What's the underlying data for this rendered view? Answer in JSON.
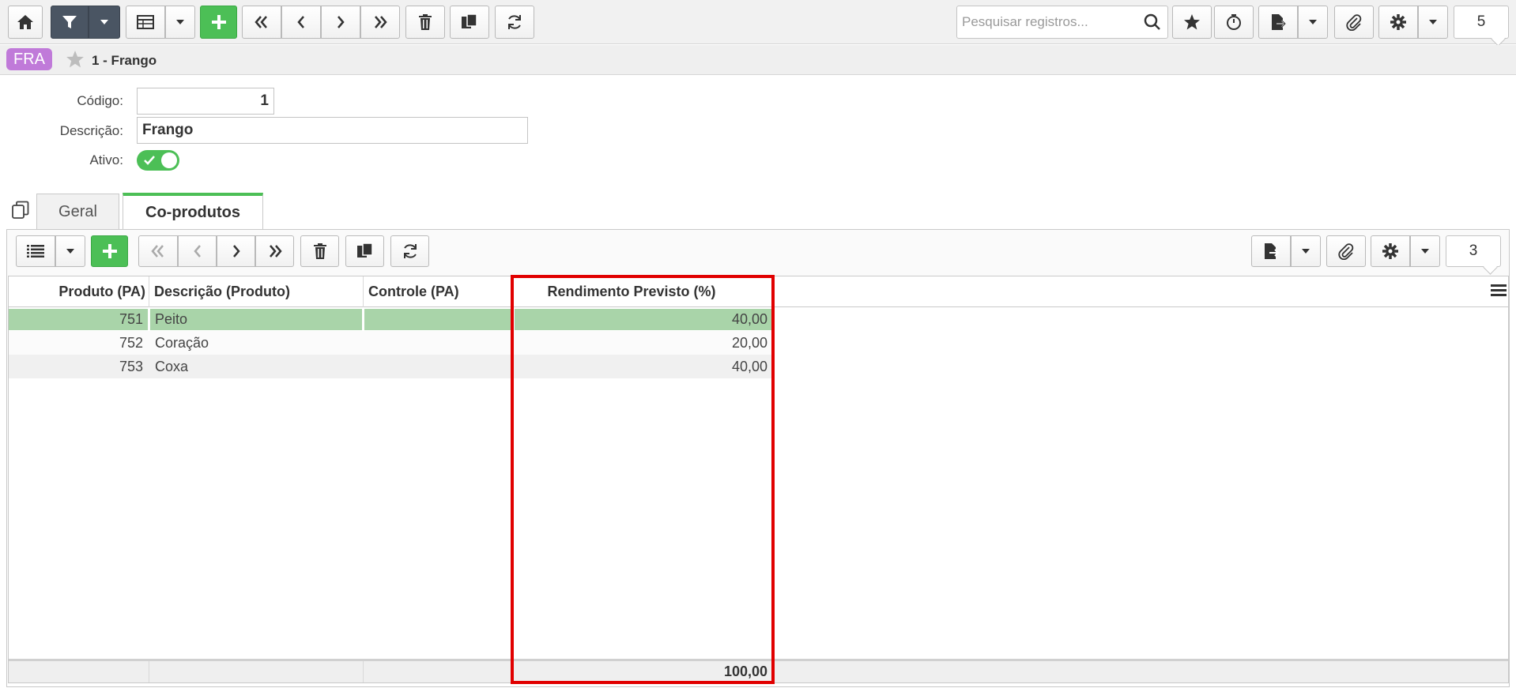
{
  "toolbar": {
    "search_placeholder": "Pesquisar registros...",
    "record_count": "5",
    "icons": [
      "home-icon",
      "filter-icon",
      "table-view-icon",
      "plus-icon",
      "first-icon",
      "prev-icon",
      "next-icon",
      "last-icon",
      "trash-icon",
      "copy-icon",
      "refresh-icon",
      "search-icon",
      "star-icon",
      "timer-icon",
      "export-icon",
      "paperclip-icon",
      "gear-icon"
    ]
  },
  "record": {
    "badge": "FRA",
    "title": "1 - Frango"
  },
  "form": {
    "codigo_label": "Código:",
    "codigo_value": "1",
    "descricao_label": "Descrição:",
    "descricao_value": "Frango",
    "ativo_label": "Ativo:",
    "ativo_on": true
  },
  "tabs": [
    {
      "label": "Geral",
      "active": false
    },
    {
      "label": "Co-produtos",
      "active": true
    }
  ],
  "grid": {
    "record_count": "3",
    "columns": [
      "Produto (PA)",
      "Descrição (Produto)",
      "Controle (PA)",
      "Rendimento Previsto (%)"
    ],
    "rows": [
      {
        "produto": "751",
        "descricao": "Peito",
        "controle": "",
        "rendimento": "40,00",
        "selected": true
      },
      {
        "produto": "752",
        "descricao": "Coração",
        "controle": "",
        "rendimento": "20,00",
        "selected": false
      },
      {
        "produto": "753",
        "descricao": "Coxa",
        "controle": "",
        "rendimento": "40,00",
        "selected": false
      }
    ],
    "total_rendimento": "100,00"
  },
  "colors": {
    "accent_green": "#4cbf56",
    "badge_purple": "#c07ad9",
    "dark_button": "#4a5563",
    "selected_row": "#a9d4a9",
    "highlight_red": "#e10000"
  }
}
